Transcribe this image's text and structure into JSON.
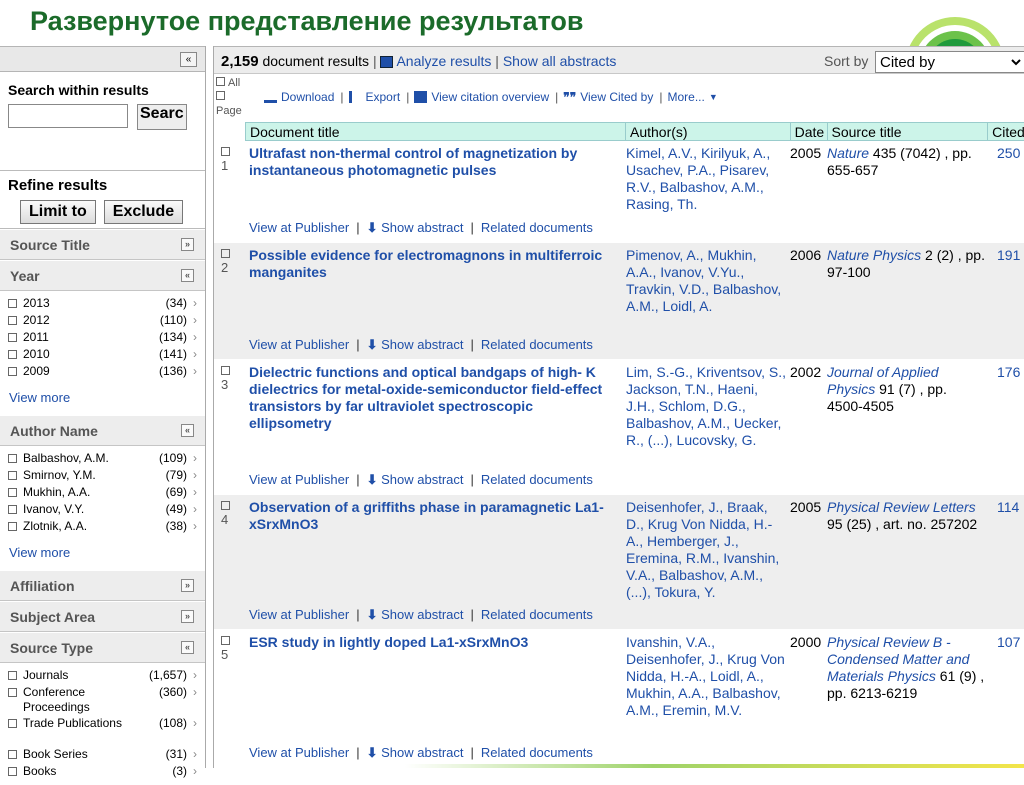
{
  "slide_title": "Развернутое представление результатов",
  "sidebar": {
    "collapse_label": "«",
    "search_label": "Search within results",
    "search_value": "",
    "search_button": "Searc",
    "refine_label": "Refine results",
    "limit_button": "Limit to",
    "exclude_button": "Exclude",
    "facets": {
      "source_title": {
        "label": "Source Title",
        "toggle": "»"
      },
      "year": {
        "label": "Year",
        "toggle": "«",
        "items": [
          {
            "name": "2013",
            "count": "(34)"
          },
          {
            "name": "2012",
            "count": "(110)"
          },
          {
            "name": "2011",
            "count": "(134)"
          },
          {
            "name": "2010",
            "count": "(141)"
          },
          {
            "name": "2009",
            "count": "(136)"
          }
        ],
        "view_more": "View more"
      },
      "author_name": {
        "label": "Author Name",
        "toggle": "«",
        "items": [
          {
            "name": "Balbashov, A.M.",
            "count": "(109)"
          },
          {
            "name": "Smirnov, Y.M.",
            "count": "(79)"
          },
          {
            "name": "Mukhin, A.A.",
            "count": "(69)"
          },
          {
            "name": "Ivanov, V.Y.",
            "count": "(49)"
          },
          {
            "name": "Zlotnik, A.A.",
            "count": "(38)"
          }
        ],
        "view_more": "View more"
      },
      "affiliation": {
        "label": "Affiliation",
        "toggle": "»"
      },
      "subject_area": {
        "label": "Subject Area",
        "toggle": "»"
      },
      "source_type": {
        "label": "Source Type",
        "toggle": "«",
        "items": [
          {
            "name": "Journals",
            "count": "(1,657)"
          },
          {
            "name": "Conference Proceedings",
            "count": "(360)"
          },
          {
            "name": "Trade Publications",
            "count": "(108)"
          },
          {
            "name": "Book Series",
            "count": "(31)"
          },
          {
            "name": "Books",
            "count": "(3)"
          }
        ]
      }
    }
  },
  "topbar": {
    "count": "2,159",
    "count_suffix": "document results",
    "analyze": "Analyze results",
    "show_abstracts": "Show all abstracts",
    "sort_label": "Sort by",
    "sort_value": "Cited by"
  },
  "toolbar": {
    "select_all": "All",
    "select_page": "Page",
    "download": "Download",
    "export": "Export",
    "citation_overview": "View citation overview",
    "view_cited_by": "View Cited by",
    "more": "More..."
  },
  "columns": {
    "title": "Document title",
    "authors": "Author(s)",
    "date": "Date",
    "source": "Source title",
    "cited": "Cited"
  },
  "row_actions": {
    "view_publisher": "View at Publisher",
    "show_abstract": "Show abstract",
    "related": "Related documents"
  },
  "results": [
    {
      "num": "1",
      "title": "Ultrafast non-thermal control of magnetization by instantaneous photomagnetic pulses",
      "authors": "Kimel, A.V., Kirilyuk, A., Usachev, P.A., Pisarev, R.V., Balbashov, A.M., Rasing, Th.",
      "date": "2005",
      "source_name": "Nature",
      "source_detail": " 435 (7042) , pp. 655-657",
      "cited": "250"
    },
    {
      "num": "2",
      "title": "Possible evidence for electromagnons in multiferroic manganites",
      "authors": "Pimenov, A., Mukhin, A.A., Ivanov, V.Yu., Travkin, V.D., Balbashov, A.M., Loidl, A.",
      "date": "2006",
      "source_name": "Nature Physics",
      "source_detail": " 2 (2) , pp. 97-100",
      "cited": "191"
    },
    {
      "num": "3",
      "title": "Dielectric functions and optical bandgaps of high- K dielectrics for metal-oxide-semiconductor field-effect transistors by far ultraviolet spectroscopic ellipsometry",
      "authors": "Lim, S.-G., Kriventsov, S., Jackson, T.N., Haeni, J.H., Schlom, D.G., Balbashov, A.M., Uecker, R., (...), Lucovsky, G.",
      "date": "2002",
      "source_name": "Journal of Applied Physics",
      "source_detail": " 91 (7) , pp. 4500-4505",
      "cited": "176"
    },
    {
      "num": "4",
      "title": "Observation of a griffiths phase in paramagnetic La1-xSrxMnO3",
      "authors": "Deisenhofer, J., Braak, D., Krug Von Nidda, H.-A., Hemberger, J., Eremina, R.M., Ivanshin, V.A., Balbashov, A.M., (...), Tokura, Y.",
      "date": "2005",
      "source_name": "Physical Review Letters",
      "source_detail": " 95 (25) , art. no. 257202",
      "cited": "114"
    },
    {
      "num": "5",
      "title": "ESR study in lightly doped La1-xSrxMnO3",
      "authors": "Ivanshin, V.A., Deisenhofer, J., Krug Von Nidda, H.-A., Loidl, A., Mukhin, A.A., Balbashov, A.M., Eremin, M.V.",
      "date": "2000",
      "source_name": "Physical Review B - Condensed Matter and Materials Physics",
      "source_detail": " 61 (9) , pp. 6213-6219",
      "cited": "107"
    }
  ]
}
